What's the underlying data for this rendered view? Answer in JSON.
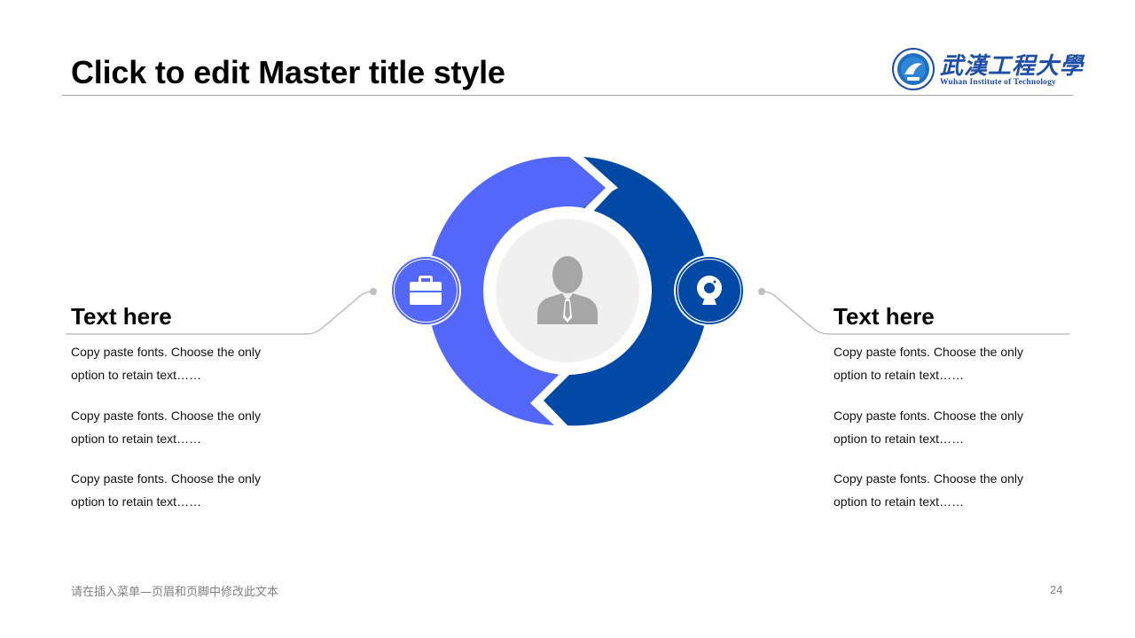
{
  "slide": {
    "title": "Click to edit Master title style",
    "page_number": "24",
    "footer": "请在插入菜单—页眉和页脚中修改此文本"
  },
  "logo": {
    "chinese_name": "武漢工程大學",
    "english_name": "Wuhan Institute of Technology"
  },
  "left_panel": {
    "heading": "Text here",
    "paragraphs": [
      "Copy paste fonts. Choose the only option to retain text……",
      "Copy paste fonts. Choose the only option to retain text……",
      "Copy paste fonts. Choose the only option to retain text……"
    ],
    "icon": "briefcase-icon"
  },
  "right_panel": {
    "heading": "Text here",
    "paragraphs": [
      "Copy paste fonts. Choose the only option to retain text……",
      "Copy paste fonts. Choose the only option to retain text……",
      "Copy paste fonts. Choose the only option to retain text……"
    ],
    "icon": "webcam-icon"
  },
  "center": {
    "icon": "person-icon"
  },
  "colors": {
    "accent_light": "#5367fb",
    "accent_dark": "#004aa5",
    "center_fill": "#f0f0f0",
    "person_gray": "#a6a6a6",
    "connector_gray": "#bfbfbf"
  }
}
